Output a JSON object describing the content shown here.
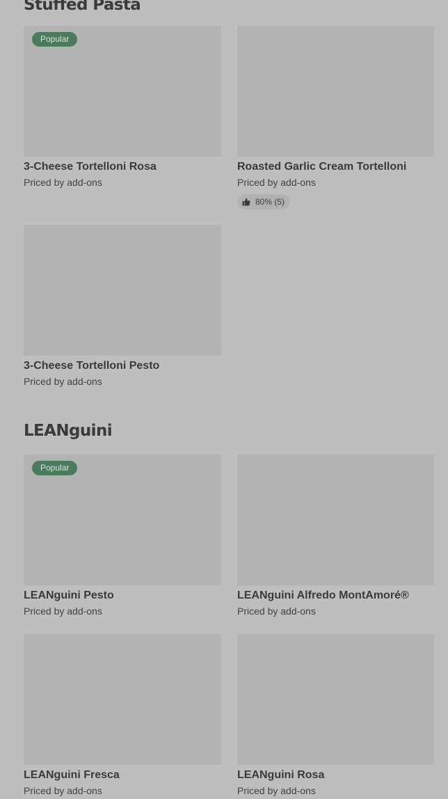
{
  "sections": [
    {
      "title": "Stuffed Pasta",
      "items": [
        {
          "name": "3-Cheese Tortelloni Rosa",
          "price": "Priced by add-ons",
          "badge": "Popular"
        },
        {
          "name": "Roasted Garlic Cream Tortelloni",
          "price": "Priced by add-ons",
          "rating": "80% (5)"
        },
        {
          "name": "3-Cheese Tortelloni Pesto",
          "price": "Priced by add-ons"
        }
      ]
    },
    {
      "title": "LEANguini",
      "items": [
        {
          "name": "LEANguini Pesto",
          "price": "Priced by add-ons",
          "badge": "Popular"
        },
        {
          "name": "LEANguini Alfredo MontAmoré®",
          "price": "Priced by add-ons"
        },
        {
          "name": "LEANguini Fresca",
          "price": "Priced by add-ons"
        },
        {
          "name": "LEANguini Rosa",
          "price": "Priced by add-ons"
        }
      ]
    }
  ],
  "icons": {
    "rating": "thumbs-up-icon"
  },
  "colors": {
    "background": "#bebebe",
    "thumbnail": "#b3b3b3",
    "badge": "#4a7b5c"
  }
}
